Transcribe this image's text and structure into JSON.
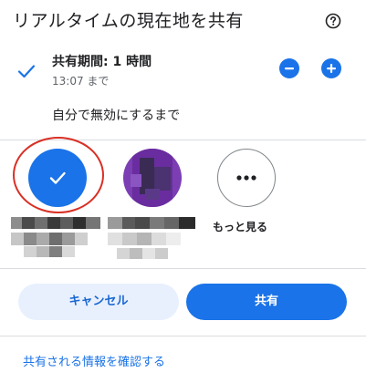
{
  "header": {
    "title": "リアルタイムの現在地を共有",
    "help_icon": "help-circle-icon"
  },
  "duration": {
    "label": "共有期間: 1 時間",
    "until": "13:07 まで",
    "decrease_icon": "minus-icon",
    "increase_icon": "plus-icon",
    "selected": true
  },
  "option_until_off": {
    "label": "自分で無効にするまで"
  },
  "recipients": {
    "more_label": "もっと見る",
    "more_icon": "more-horiz-icon",
    "selected_icon": "checkmark-icon"
  },
  "actions": {
    "cancel_label": "キャンセル",
    "share_label": "共有"
  },
  "footer": {
    "link_label": "共有される情報を確認する"
  },
  "colors": {
    "accent": "#1a73e8",
    "accent_light": "#e8f0fe",
    "highlight_ring": "#d93025"
  }
}
